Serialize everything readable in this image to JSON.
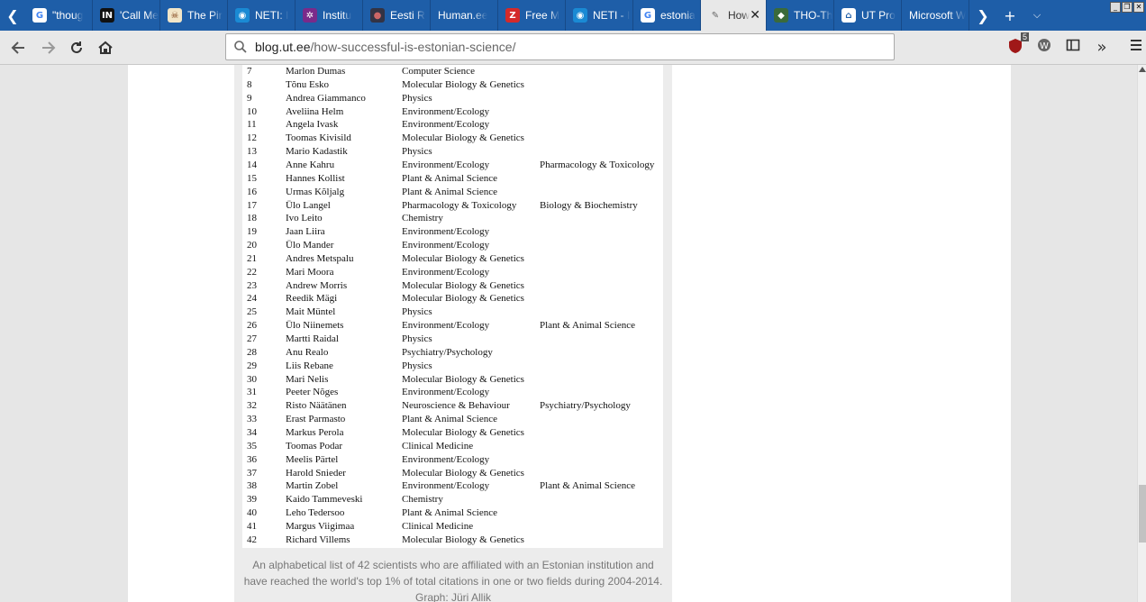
{
  "browser": {
    "tabs": [
      {
        "label": "\"thoug",
        "icon": "google-icon",
        "bg": "#ffffff",
        "fg": "#4285f4",
        "glyph": "G"
      },
      {
        "label": "'Call Me",
        "icon": "indeed-icon",
        "bg": "#111111",
        "fg": "#ffffff",
        "glyph": "IN"
      },
      {
        "label": "The Pir",
        "icon": "pirate-icon",
        "bg": "#f2e6c8",
        "fg": "#7a3b12",
        "glyph": "☠"
      },
      {
        "label": "NETI: I",
        "icon": "neti-icon",
        "bg": "#1a8ad4",
        "fg": "#ffffff",
        "glyph": "◉"
      },
      {
        "label": "Institu",
        "icon": "institute-icon",
        "bg": "#7a2a8a",
        "fg": "#ffffff",
        "glyph": "✲"
      },
      {
        "label": "Eesti R",
        "icon": "eesti-icon",
        "bg": "#334",
        "fg": "#c66",
        "glyph": "●"
      },
      {
        "label": "Human.ee",
        "icon": "human-icon",
        "bg": "#1e5ea8",
        "fg": "#ffffff",
        "glyph": ""
      },
      {
        "label": "Free M",
        "icon": "zotero-icon",
        "bg": "#d42a2a",
        "fg": "#ffffff",
        "glyph": "Z"
      },
      {
        "label": "NETI - I",
        "icon": "neti-icon",
        "bg": "#1a8ad4",
        "fg": "#ffffff",
        "glyph": "◉"
      },
      {
        "label": "estonia",
        "icon": "google-icon",
        "bg": "#ffffff",
        "fg": "#4285f4",
        "glyph": "G"
      },
      {
        "label": "How",
        "icon": "blog-icon",
        "bg": "#e8e8e8",
        "fg": "#666",
        "glyph": "✎",
        "active": true
      },
      {
        "label": "THO-Th",
        "icon": "tho-icon",
        "bg": "#3a6a3a",
        "fg": "#ffffff",
        "glyph": "◆"
      },
      {
        "label": "UT Pro",
        "icon": "ut-icon",
        "bg": "#ffffff",
        "fg": "#1e5ea8",
        "glyph": "⌂"
      },
      {
        "label": "Microsoft W",
        "icon": "microsoft-icon",
        "bg": "#1e5ea8",
        "fg": "#ffffff",
        "glyph": ""
      }
    ],
    "url_host": "blog.ut.ee",
    "url_path": "/how-successful-is-estonian-science/",
    "ublock_badge": "5"
  },
  "table_rows": [
    {
      "n": "7",
      "name": "Marlon Dumas",
      "f1": "Computer Science",
      "f2": ""
    },
    {
      "n": "8",
      "name": "Tõnu Esko",
      "f1": "Molecular Biology & Genetics",
      "f2": ""
    },
    {
      "n": "9",
      "name": "Andrea Giammanco",
      "f1": "Physics",
      "f2": ""
    },
    {
      "n": "10",
      "name": "Aveliina Helm",
      "f1": "Environment/Ecology",
      "f2": ""
    },
    {
      "n": "11",
      "name": "Angela Ivask",
      "f1": "Environment/Ecology",
      "f2": ""
    },
    {
      "n": "12",
      "name": "Toomas Kivisild",
      "f1": "Molecular Biology & Genetics",
      "f2": ""
    },
    {
      "n": "13",
      "name": "Mario Kadastik",
      "f1": "Physics",
      "f2": ""
    },
    {
      "n": "14",
      "name": "Anne Kahru",
      "f1": "Environment/Ecology",
      "f2": "Pharmacology & Toxicology"
    },
    {
      "n": "15",
      "name": "Hannes Kollist",
      "f1": "Plant & Animal Science",
      "f2": ""
    },
    {
      "n": "16",
      "name": "Urmas Kõljalg",
      "f1": "Plant & Animal Science",
      "f2": ""
    },
    {
      "n": "17",
      "name": "Ülo Langel",
      "f1": "Pharmacology & Toxicology",
      "f2": "Biology & Biochemistry"
    },
    {
      "n": "18",
      "name": "Ivo Leito",
      "f1": "Chemistry",
      "f2": ""
    },
    {
      "n": "19",
      "name": "Jaan Liira",
      "f1": "Environment/Ecology",
      "f2": ""
    },
    {
      "n": "20",
      "name": "Ülo Mander",
      "f1": "Environment/Ecology",
      "f2": ""
    },
    {
      "n": "21",
      "name": "Andres Metspalu",
      "f1": "Molecular Biology & Genetics",
      "f2": ""
    },
    {
      "n": "22",
      "name": "Mari Moora",
      "f1": "Environment/Ecology",
      "f2": ""
    },
    {
      "n": "23",
      "name": "Andrew Morris",
      "f1": "Molecular Biology & Genetics",
      "f2": ""
    },
    {
      "n": "24",
      "name": "Reedik Mägi",
      "f1": "Molecular Biology & Genetics",
      "f2": ""
    },
    {
      "n": "25",
      "name": "Mait Müntel",
      "f1": "Physics",
      "f2": ""
    },
    {
      "n": "26",
      "name": "Ülo Niinemets",
      "f1": "Environment/Ecology",
      "f2": "Plant & Animal Science"
    },
    {
      "n": "27",
      "name": "Martti Raidal",
      "f1": "Physics",
      "f2": ""
    },
    {
      "n": "28",
      "name": "Anu Realo",
      "f1": "Psychiatry/Psychology",
      "f2": ""
    },
    {
      "n": "29",
      "name": "Liis Rebane",
      "f1": "Physics",
      "f2": ""
    },
    {
      "n": "30",
      "name": "Mari Nelis",
      "f1": "Molecular Biology & Genetics",
      "f2": ""
    },
    {
      "n": "31",
      "name": "Peeter Nõges",
      "f1": "Environment/Ecology",
      "f2": ""
    },
    {
      "n": "32",
      "name": "Risto Näätänen",
      "f1": "Neuroscience & Behaviour",
      "f2": "Psychiatry/Psychology"
    },
    {
      "n": "33",
      "name": "Erast Parmasto",
      "f1": "Plant & Animal Science",
      "f2": ""
    },
    {
      "n": "34",
      "name": "Markus Perola",
      "f1": "Molecular Biology & Genetics",
      "f2": ""
    },
    {
      "n": "35",
      "name": "Toomas Podar",
      "f1": "Clinical Medicine",
      "f2": ""
    },
    {
      "n": "36",
      "name": "Meelis Pärtel",
      "f1": "Environment/Ecology",
      "f2": ""
    },
    {
      "n": "37",
      "name": "Harold Snieder",
      "f1": "Molecular Biology & Genetics",
      "f2": ""
    },
    {
      "n": "38",
      "name": "Martin Zobel",
      "f1": "Environment/Ecology",
      "f2": "Plant & Animal Science"
    },
    {
      "n": "39",
      "name": "Kaido Tammeveski",
      "f1": "Chemistry",
      "f2": ""
    },
    {
      "n": "40",
      "name": "Leho Tedersoo",
      "f1": "Plant & Animal Science",
      "f2": ""
    },
    {
      "n": "41",
      "name": "Margus Viigimaa",
      "f1": "Clinical Medicine",
      "f2": ""
    },
    {
      "n": "42",
      "name": "Richard Villems",
      "f1": "Molecular Biology & Genetics",
      "f2": ""
    }
  ],
  "caption": "An alphabetical list of 42 scientists who are affiliated with an Estonian institution and have reached the world's top 1% of total citations in one or two fields during 2004-2014. Graph: Jüri Allik"
}
